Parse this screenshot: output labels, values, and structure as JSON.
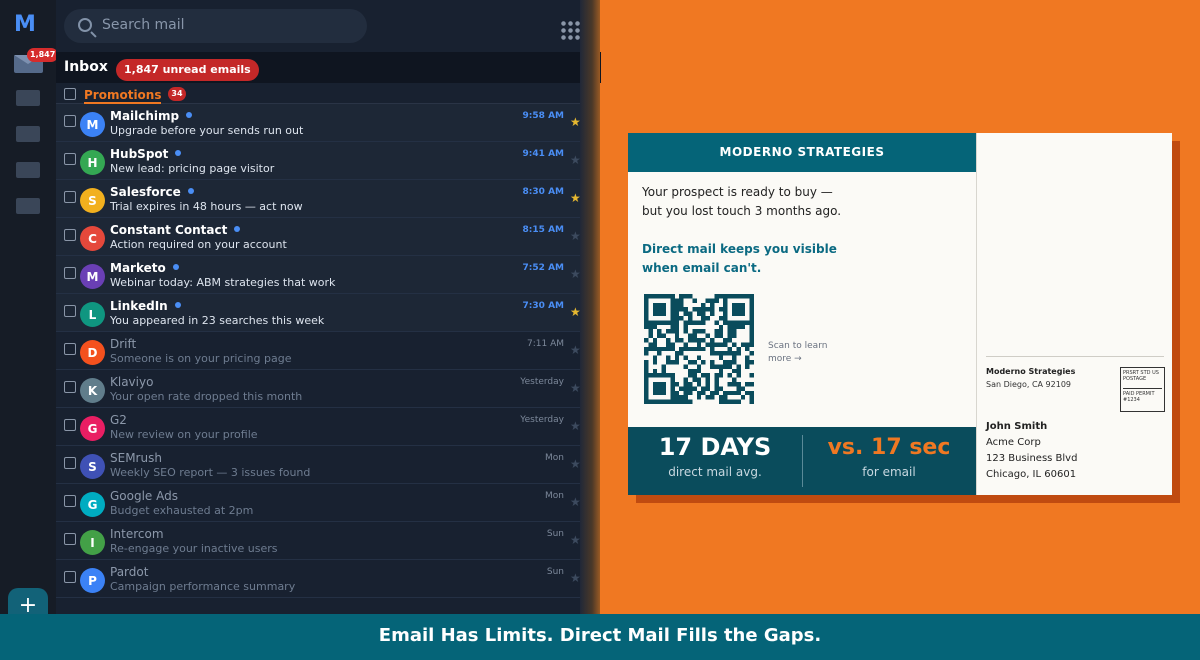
{
  "rail": {
    "logo": "M",
    "badge": "1,847",
    "compose": "+"
  },
  "search": {
    "placeholder": "Search mail"
  },
  "inbox": {
    "title": "Inbox",
    "unread_pill": "1,847 unread emails"
  },
  "category": {
    "label": "Promotions",
    "count": "34"
  },
  "emails": [
    {
      "initial": "M",
      "sender": "Mailchimp",
      "subject": "Upgrade before your sends run out",
      "time": "9:58 AM",
      "unread": true,
      "starred": true,
      "color": "#3b82f6"
    },
    {
      "initial": "H",
      "sender": "HubSpot",
      "subject": "New lead: pricing page visitor",
      "time": "9:41 AM",
      "unread": true,
      "starred": false,
      "color": "#34a853"
    },
    {
      "initial": "S",
      "sender": "Salesforce",
      "subject": "Trial expires in 48 hours — act now",
      "time": "8:30 AM",
      "unread": true,
      "starred": true,
      "color": "#f2b01e"
    },
    {
      "initial": "C",
      "sender": "Constant Contact",
      "subject": "Action required on your account",
      "time": "8:15 AM",
      "unread": true,
      "starred": false,
      "color": "#e5483b"
    },
    {
      "initial": "M",
      "sender": "Marketo",
      "subject": "Webinar today: ABM strategies that work",
      "time": "7:52 AM",
      "unread": true,
      "starred": false,
      "color": "#6a3fb5"
    },
    {
      "initial": "L",
      "sender": "LinkedIn",
      "subject": "You appeared in 23 searches this week",
      "time": "7:30 AM",
      "unread": true,
      "starred": true,
      "color": "#0f9680"
    },
    {
      "initial": "D",
      "sender": "Drift",
      "subject": "Someone is on your pricing page",
      "time": "7:11 AM",
      "unread": false,
      "starred": false,
      "color": "#f4511e"
    },
    {
      "initial": "K",
      "sender": "Klaviyo",
      "subject": "Your open rate dropped this month",
      "time": "Yesterday",
      "unread": false,
      "starred": false,
      "color": "#607d8b"
    },
    {
      "initial": "G",
      "sender": "G2",
      "subject": "New review on your profile",
      "time": "Yesterday",
      "unread": false,
      "starred": false,
      "color": "#e91e63"
    },
    {
      "initial": "S",
      "sender": "SEMrush",
      "subject": "Weekly SEO report — 3 issues found",
      "time": "Mon",
      "unread": false,
      "starred": false,
      "color": "#3f51b5"
    },
    {
      "initial": "G",
      "sender": "Google Ads",
      "subject": "Budget exhausted at 2pm",
      "time": "Mon",
      "unread": false,
      "starred": false,
      "color": "#00acc1"
    },
    {
      "initial": "I",
      "sender": "Intercom",
      "subject": "Re-engage your inactive users",
      "time": "Sun",
      "unread": false,
      "starred": false,
      "color": "#43a047"
    },
    {
      "initial": "P",
      "sender": "Pardot",
      "subject": "Campaign performance summary",
      "time": "Sun",
      "unread": false,
      "starred": false,
      "color": "#3b82f6"
    }
  ],
  "postcard": {
    "brand": "MODERNO STRATEGIES",
    "line1": "Your prospect is ready to buy —",
    "line2": "but you lost touch 3 months ago.",
    "line3": "Direct mail keeps you visible",
    "line4": "when email can't.",
    "scan1": "Scan to learn",
    "scan2": "more →",
    "stat1_value": "17 DAYS",
    "stat1_label": "direct mail avg.",
    "stat2_value": "vs. 17 sec",
    "stat2_label": "for email",
    "from_name": "Moderno Strategies",
    "from_city": "San Diego, CA 92109",
    "stamp_top": "PRSRT STD US POSTAGE",
    "stamp_bottom": "PAID PERMIT #1234",
    "to_name": "John Smith",
    "to_company": "Acme Corp",
    "to_street": "123 Business Blvd",
    "to_city": "Chicago, IL 60601"
  },
  "banner": "Email Has Limits. Direct Mail Fills the Gaps."
}
